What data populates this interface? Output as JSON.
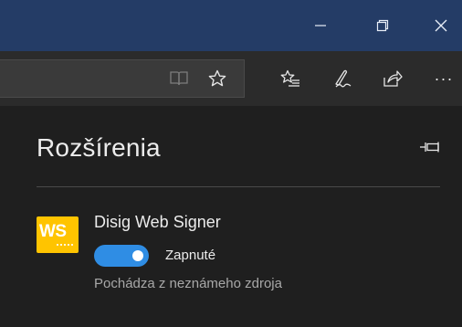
{
  "titlebar": {
    "controls": [
      {
        "name": "minimize-button",
        "icon": "minimize-icon"
      },
      {
        "name": "restore-button",
        "icon": "restore-icon"
      },
      {
        "name": "close-button",
        "icon": "close-icon"
      }
    ]
  },
  "toolbar": {
    "address_icons": [
      "reading-view-icon",
      "favorite-star-icon"
    ],
    "icons": [
      "favorites-hub-icon",
      "web-note-icon",
      "share-icon",
      "more-icon"
    ],
    "more_label": "···"
  },
  "extensions_panel": {
    "title": "Rozšírenia",
    "extension": {
      "logo_text": "WS",
      "name": "Disig Web Signer",
      "enabled": true,
      "status_label": "Zapnuté",
      "origin": "Pochádza z neznámeho zdroja"
    }
  },
  "colors": {
    "titlebar": "#243c66",
    "toolbar": "#2b2b2b",
    "panel": "#1f1f1f",
    "accent": "#2f8de4",
    "logo": "#ffc400"
  }
}
